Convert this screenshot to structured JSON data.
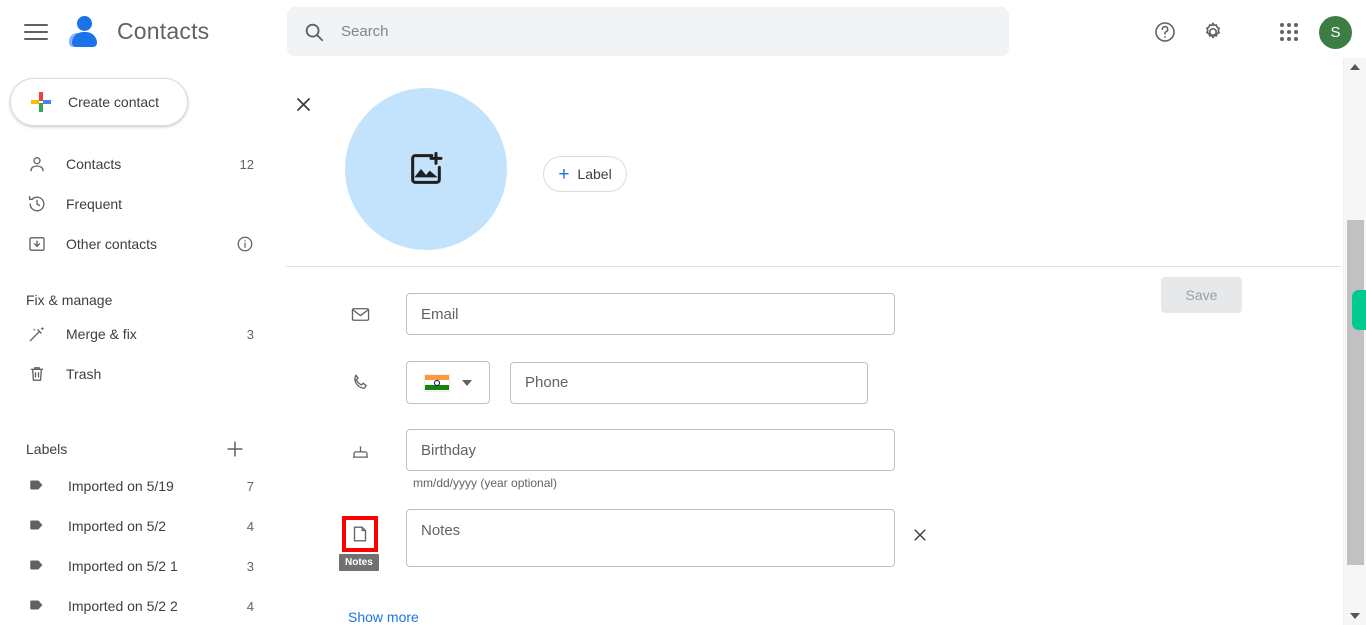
{
  "app": {
    "title": "Contacts",
    "brand_icon": "contacts-person-icon",
    "menu_icon": "hamburger-menu-icon"
  },
  "search": {
    "placeholder": "Search",
    "value": "",
    "icon": "search-icon"
  },
  "top_actions": {
    "help_icon": "help-circle-icon",
    "settings_icon": "gear-icon",
    "apps_icon": "apps-grid-icon",
    "avatar_initial": "S",
    "avatar_color": "#3c7d44"
  },
  "sidebar": {
    "create_button": {
      "label": "Create contact",
      "icon": "google-plus-icon"
    },
    "nav_items": [
      {
        "label": "Contacts",
        "count": "12",
        "icon": "person-outline-icon"
      },
      {
        "label": "Frequent",
        "count": "",
        "icon": "history-clock-icon"
      },
      {
        "label": "Other contacts",
        "count": "",
        "icon": "archive-box-icon",
        "info_icon": "info-circle-icon"
      }
    ],
    "fix_manage": {
      "title": "Fix & manage",
      "items": [
        {
          "label": "Merge & fix",
          "count": "3",
          "icon": "magic-wand-icon"
        },
        {
          "label": "Trash",
          "count": "",
          "icon": "trash-icon"
        }
      ]
    },
    "labels": {
      "title": "Labels",
      "add_icon": "plus-icon",
      "items": [
        {
          "label": "Imported on 5/19",
          "count": "7",
          "icon": "tag-icon"
        },
        {
          "label": "Imported on 5/2",
          "count": "4",
          "icon": "tag-icon"
        },
        {
          "label": "Imported on 5/2 1",
          "count": "3",
          "icon": "tag-icon"
        },
        {
          "label": "Imported on 5/2 2",
          "count": "4",
          "icon": "tag-icon"
        }
      ]
    }
  },
  "contact_form": {
    "close_icon": "close-x-icon",
    "photo": {
      "icon": "add-photo-icon",
      "background_color": "#c2e3fb"
    },
    "label_button": {
      "plus": "+",
      "text": "Label"
    },
    "save_button": {
      "label": "Save",
      "disabled": true
    },
    "fields": {
      "email": {
        "placeholder": "Email",
        "value": "",
        "icon": "envelope-icon"
      },
      "phone": {
        "placeholder": "Phone",
        "value": "",
        "icon": "phone-icon",
        "country_flag": "india-flag-icon",
        "country_caret": "chevron-down-icon"
      },
      "birthday": {
        "placeholder": "Birthday",
        "value": "",
        "icon": "cake-icon",
        "hint": "mm/dd/yyyy (year optional)"
      },
      "notes": {
        "placeholder": "Notes",
        "value": "",
        "icon": "note-page-icon",
        "tooltip": "Notes",
        "highlight_color": "#ff0000",
        "delete_icon": "close-x-icon"
      }
    },
    "show_more": "Show more"
  },
  "scrollbar": {
    "up_arrow": "triangle-up-icon",
    "down_arrow": "triangle-down-icon",
    "thumb_color": "#c1c1c1",
    "accent_color": "#00ca8e"
  }
}
